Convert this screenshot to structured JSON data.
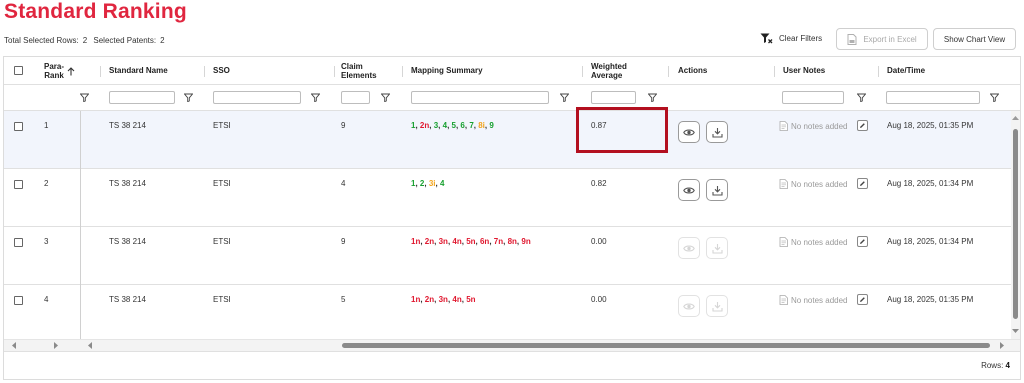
{
  "title": "Standard Ranking",
  "selection": {
    "rows_label": "Total Selected Rows:",
    "rows_value": "2",
    "patents_label": "Selected Patents:",
    "patents_value": "2"
  },
  "toolbar": {
    "clear_filters": "Clear Filters",
    "export_excel": "Export in Excel",
    "show_chart": "Show Chart View"
  },
  "columns": {
    "para_rank": "Para-\nRank",
    "standard_name": "Standard Name",
    "sso": "SSO",
    "claim_elements": "Claim\nElements",
    "mapping_summary": "Mapping Summary",
    "weighted_average": "Weighted\nAverage",
    "actions": "Actions",
    "user_notes": "User Notes",
    "date_time": "Date/Time"
  },
  "rows": [
    {
      "rank": "1",
      "standard": "TS 38 214",
      "sso": "ETSI",
      "claims": "9",
      "mapping": [
        {
          "t": "1",
          "c": "g"
        },
        {
          "t": "2n",
          "c": "r"
        },
        {
          "t": "3",
          "c": "g"
        },
        {
          "t": "4",
          "c": "g"
        },
        {
          "t": "5",
          "c": "g"
        },
        {
          "t": "6",
          "c": "g"
        },
        {
          "t": "7",
          "c": "g"
        },
        {
          "t": "8i",
          "c": "o"
        },
        {
          "t": "9",
          "c": "g"
        }
      ],
      "weighted": "0.87",
      "notes": "No notes added",
      "datetime": "Aug 18, 2025, 01:35 PM",
      "actions_enabled": true,
      "selected": true
    },
    {
      "rank": "2",
      "standard": "TS 38 214",
      "sso": "ETSI",
      "claims": "4",
      "mapping": [
        {
          "t": "1",
          "c": "g"
        },
        {
          "t": "2",
          "c": "g"
        },
        {
          "t": "3i",
          "c": "o"
        },
        {
          "t": "4",
          "c": "g"
        }
      ],
      "weighted": "0.82",
      "notes": "No notes added",
      "datetime": "Aug 18, 2025, 01:34 PM",
      "actions_enabled": true,
      "selected": false
    },
    {
      "rank": "3",
      "standard": "TS 38 214",
      "sso": "ETSI",
      "claims": "9",
      "mapping": [
        {
          "t": "1n",
          "c": "r"
        },
        {
          "t": "2n",
          "c": "r"
        },
        {
          "t": "3n",
          "c": "r"
        },
        {
          "t": "4n",
          "c": "r"
        },
        {
          "t": "5n",
          "c": "r"
        },
        {
          "t": "6n",
          "c": "r"
        },
        {
          "t": "7n",
          "c": "r"
        },
        {
          "t": "8n",
          "c": "r"
        },
        {
          "t": "9n",
          "c": "r"
        }
      ],
      "weighted": "0.00",
      "notes": "No notes added",
      "datetime": "Aug 18, 2025, 01:34 PM",
      "actions_enabled": false,
      "selected": false
    },
    {
      "rank": "4",
      "standard": "TS 38 214",
      "sso": "ETSI",
      "claims": "5",
      "mapping": [
        {
          "t": "1n",
          "c": "r"
        },
        {
          "t": "2n",
          "c": "r"
        },
        {
          "t": "3n",
          "c": "r"
        },
        {
          "t": "4n",
          "c": "r"
        },
        {
          "t": "5n",
          "c": "r"
        }
      ],
      "weighted": "0.00",
      "notes": "No notes added",
      "datetime": "Aug 18, 2025, 01:35 PM",
      "actions_enabled": false,
      "selected": false
    }
  ],
  "footer": {
    "rows_label": "Rows:",
    "rows_value": "4"
  },
  "colors": {
    "title": "#e0263f",
    "match_full": "#17a02f",
    "match_none": "#e0182f",
    "match_partial": "#f2a31a",
    "highlight_box": "#b30f1f"
  }
}
